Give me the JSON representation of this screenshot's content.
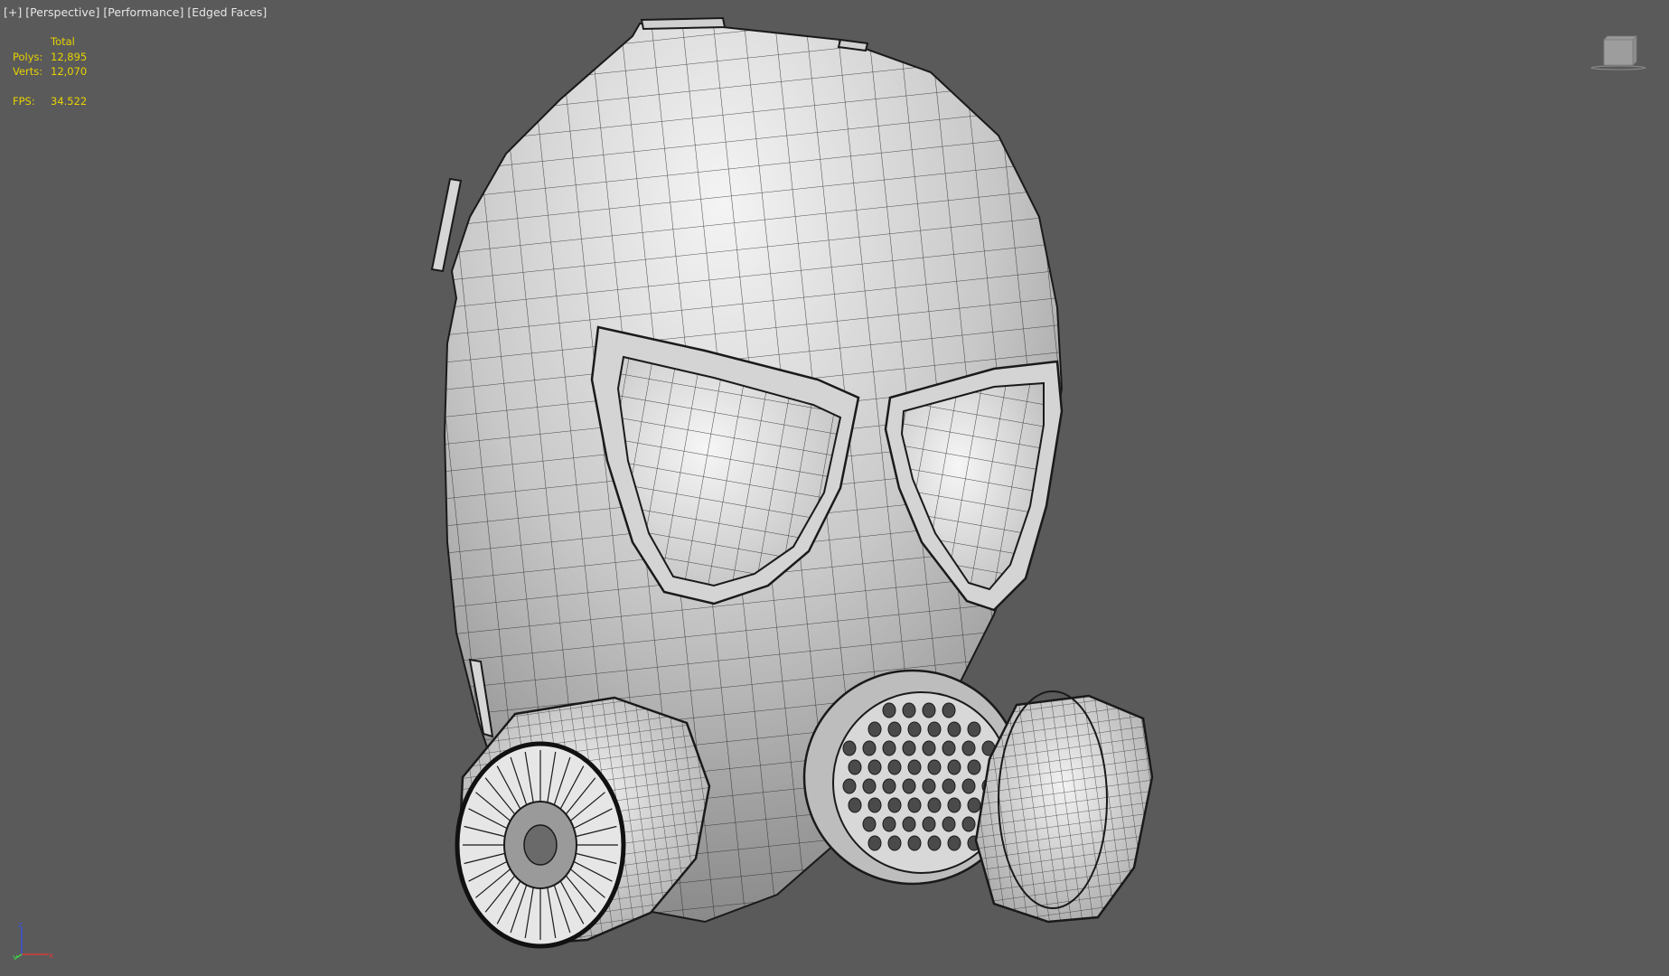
{
  "viewport": {
    "label_plus": "[+]",
    "label_view": "[Perspective]",
    "label_mode": "[Performance]",
    "label_shading": "[Edged Faces]"
  },
  "stats": {
    "header": "Total",
    "polys_label": "Polys:",
    "polys_value": "12,895",
    "verts_label": "Verts:",
    "verts_value": "12,070",
    "fps_label": "FPS:",
    "fps_value": "34.522"
  },
  "viewcube": {
    "icon": "viewcube-icon"
  },
  "axis_tripod": {
    "icon": "axis-tripod-icon",
    "labels": [
      "z",
      "y",
      "x"
    ]
  },
  "colors": {
    "background": "#5a5a5a",
    "stats_text": "#e8d200",
    "label_text": "#e6e6e6",
    "wire": "#1a1a1a"
  }
}
